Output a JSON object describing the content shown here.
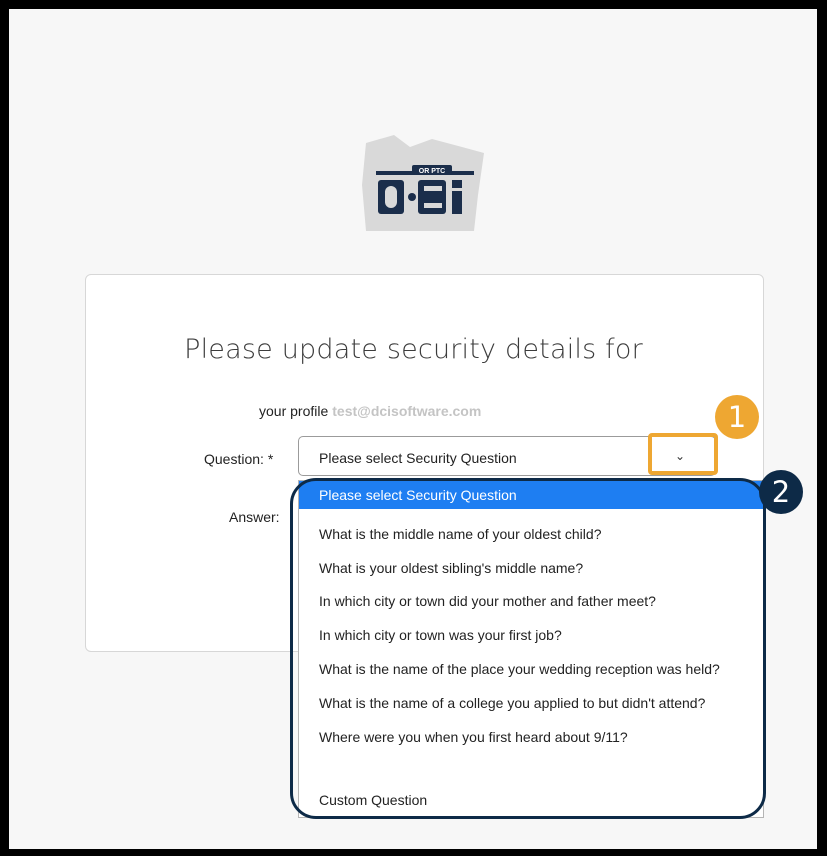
{
  "logo": {
    "badge_text": "OR PTC",
    "brand_text": "DCI"
  },
  "heading": {
    "title": "Please update security details for"
  },
  "profile": {
    "label": "your profile",
    "email": "test@dcisoftware.com"
  },
  "form": {
    "question_label": "Question: *",
    "answer_label": "Answer:",
    "question_selected": "Please select Security Question"
  },
  "dropdown": {
    "options": [
      "Please select Security Question",
      "What is the middle name of your oldest child?",
      "What is your oldest sibling's middle name?",
      "In which city or town did your mother and father meet?",
      "In which city or town was your first job?",
      "What is the name of the place your wedding reception was held?",
      "What is the name of a college you applied to but didn't attend?",
      "Where were you when you first heard about 9/11?",
      "Custom Question"
    ]
  },
  "callouts": {
    "one": "1",
    "two": "2"
  },
  "colors": {
    "callout_orange": "#eea732",
    "callout_navy": "#0d2a47",
    "selection_blue": "#1e7ef2"
  }
}
